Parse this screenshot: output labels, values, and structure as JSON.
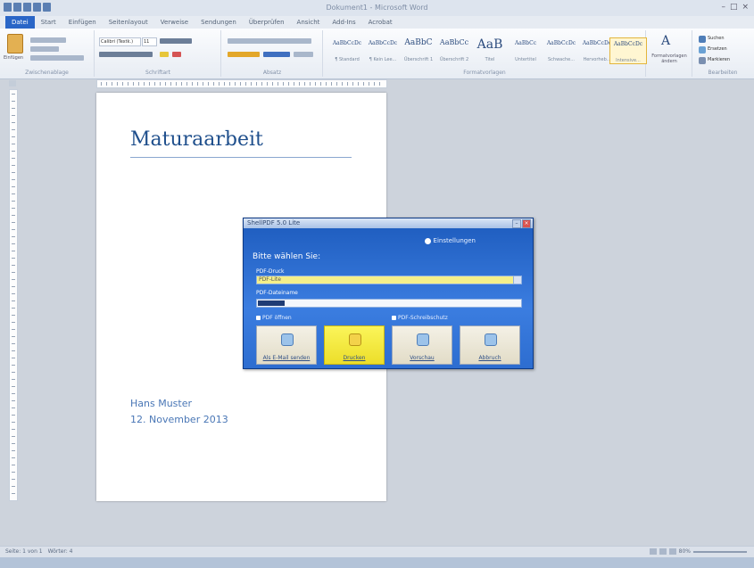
{
  "window": {
    "title": "Dokument1 - Microsoft Word",
    "min": "–",
    "max": "□",
    "close": "×"
  },
  "tabs": [
    {
      "label": "Datei"
    },
    {
      "label": "Start"
    },
    {
      "label": "Einfügen"
    },
    {
      "label": "Seitenlayout"
    },
    {
      "label": "Verweise"
    },
    {
      "label": "Sendungen"
    },
    {
      "label": "Überprüfen"
    },
    {
      "label": "Ansicht"
    },
    {
      "label": "Add-Ins"
    },
    {
      "label": "Acrobat"
    }
  ],
  "ribbon": {
    "clipboard_label": "Zwischenablage",
    "paste_label": "Einfügen",
    "font_label": "Schriftart",
    "font_name": "Calibri (Textk.)",
    "font_size": "11",
    "paragraph_label": "Absatz",
    "styles_label": "Formatvorlagen",
    "edit_label": "Bearbeiten",
    "change_styles_label": "Formatvorlagen ändern",
    "styles": [
      {
        "sample": "AaBbCcDc",
        "caption": "¶ Standard"
      },
      {
        "sample": "AaBbCcDc",
        "caption": "¶ Kein Lee..."
      },
      {
        "sample": "AaBbC",
        "caption": "Überschrift 1"
      },
      {
        "sample": "AaBbCc",
        "caption": "Überschrift 2"
      },
      {
        "sample": "AaB",
        "caption": "Titel"
      },
      {
        "sample": "AaBbCc",
        "caption": "Untertitel"
      },
      {
        "sample": "AaBbCcDc",
        "caption": "Schwache..."
      },
      {
        "sample": "AaBbCcDc",
        "caption": "Hervorheb..."
      },
      {
        "sample": "AaBbCcDc",
        "caption": "Intensive..."
      }
    ],
    "edit_items": [
      "Suchen",
      "Ersetzen",
      "Markieren"
    ]
  },
  "document": {
    "title": "Maturaarbeit",
    "author": "Hans Muster",
    "date": "12. November 2013"
  },
  "dialog": {
    "title": "ShellPDF 5.0 Lite",
    "link_label": "Einstellungen",
    "prompt": "Bitte wählen Sie:",
    "field1_label": "PDF-Druck",
    "field1_value": "PDF-Lite",
    "field2_label": "PDF-Dateiname",
    "section1_label": "PDF öffnen",
    "section2_label": "PDF-Schreibschutz",
    "buttons": [
      {
        "label": "Als E-Mail senden",
        "active": false
      },
      {
        "label": "Drucken",
        "active": true
      },
      {
        "label": "Vorschau",
        "active": false
      },
      {
        "label": "Abbruch",
        "active": false
      }
    ]
  },
  "status": {
    "page": "Seite: 1 von 1",
    "words": "Wörter: 4",
    "zoom": "80%"
  },
  "colors": {
    "accent": "#2a66c7",
    "doc_title": "#1f4f8c",
    "doc_text": "#4a77b6",
    "dialog_bg": "#2d6dd0",
    "highlight": "#f4ef8a"
  }
}
